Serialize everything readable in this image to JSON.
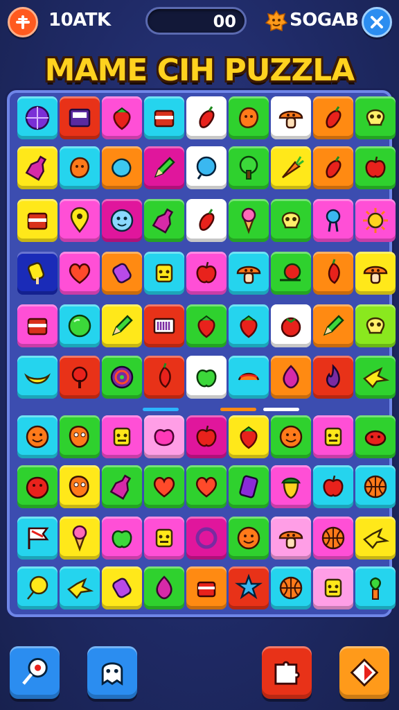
{
  "topbar": {
    "left_label": "10ATK",
    "score": "00",
    "right_label": "SOGAB"
  },
  "title": "MAME CIH PUZZLA",
  "colors": {
    "cyan": "#25d4ee",
    "red": "#e83218",
    "pink": "#ff4fd6",
    "green": "#2fd12e",
    "orange": "#ff8a12",
    "yellow": "#ffe81a",
    "lime": "#8ae81e",
    "white": "#ffffff",
    "navy": "#1a2bb8",
    "magenta": "#e0169c",
    "lightpink": "#ff9ee6",
    "blue": "#27b8ef"
  },
  "board": {
    "rows": [
      [
        {
          "color": "cyan",
          "icon": "purple-ball-icon"
        },
        {
          "color": "red",
          "icon": "tablet-icon"
        },
        {
          "color": "pink",
          "icon": "strawberry-icon"
        },
        {
          "color": "cyan",
          "icon": "box-icon"
        },
        {
          "color": "white",
          "icon": "red-pepper-icon"
        },
        {
          "color": "green",
          "icon": "orange-blob-icon"
        },
        {
          "color": "white",
          "icon": "mushroom-icon"
        },
        {
          "color": "orange",
          "icon": "red-pepper-icon"
        },
        {
          "color": "green",
          "icon": "skull-icon"
        }
      ],
      [
        {
          "color": "yellow",
          "icon": "bottle-icon"
        },
        {
          "color": "cyan",
          "icon": "orange-blob-icon"
        },
        {
          "color": "orange",
          "icon": "blue-blob-icon"
        },
        {
          "color": "magenta",
          "icon": "pencil-icon"
        },
        {
          "color": "white",
          "icon": "blue-ball-icon"
        },
        {
          "color": "green",
          "icon": "tree-icon"
        },
        {
          "color": "yellow",
          "icon": "carrot-icon"
        },
        {
          "color": "orange",
          "icon": "red-pepper-icon"
        },
        {
          "color": "green",
          "icon": "apple-icon"
        }
      ],
      [
        {
          "color": "yellow",
          "icon": "box-icon"
        },
        {
          "color": "pink",
          "icon": "location-pin-icon"
        },
        {
          "color": "magenta",
          "icon": "face-icon"
        },
        {
          "color": "green",
          "icon": "bottle-icon"
        },
        {
          "color": "white",
          "icon": "red-pepper-icon"
        },
        {
          "color": "green",
          "icon": "ice-cream-icon"
        },
        {
          "color": "green",
          "icon": "skull-icon"
        },
        {
          "color": "pink",
          "icon": "key-icon"
        },
        {
          "color": "pink",
          "icon": "sun-icon"
        }
      ],
      [
        {
          "color": "navy",
          "icon": "popsicle-icon"
        },
        {
          "color": "pink",
          "icon": "heart-icon"
        },
        {
          "color": "orange",
          "icon": "candy-bar-icon"
        },
        {
          "color": "cyan",
          "icon": "robot-icon"
        },
        {
          "color": "pink",
          "icon": "apple-icon"
        },
        {
          "color": "cyan",
          "icon": "mushroom-icon"
        },
        {
          "color": "green",
          "icon": "snail-icon"
        },
        {
          "color": "orange",
          "icon": "pepper-icon"
        },
        {
          "color": "yellow",
          "icon": "mushroom-icon"
        }
      ],
      [
        {
          "color": "pink",
          "icon": "box-icon"
        },
        {
          "color": "cyan",
          "icon": "green-ball-icon"
        },
        {
          "color": "yellow",
          "icon": "pencil-icon"
        },
        {
          "color": "red",
          "icon": "barcode-icon"
        },
        {
          "color": "green",
          "icon": "strawberry-icon"
        },
        {
          "color": "cyan",
          "icon": "strawberry-icon"
        },
        {
          "color": "white",
          "icon": "tomato-icon"
        },
        {
          "color": "orange",
          "icon": "pencil-icon"
        },
        {
          "color": "lime",
          "icon": "skull-icon"
        }
      ],
      [
        {
          "color": "cyan",
          "icon": "banana-icon"
        },
        {
          "color": "red",
          "icon": "flower-icon"
        },
        {
          "color": "green",
          "icon": "swirl-icon"
        },
        {
          "color": "red",
          "icon": "pepper-icon"
        },
        {
          "color": "white",
          "icon": "green-apple-icon"
        },
        {
          "color": "cyan",
          "icon": "candy-icon"
        },
        {
          "color": "orange",
          "icon": "onion-icon"
        },
        {
          "color": "red",
          "icon": "flame-icon"
        },
        {
          "color": "green",
          "icon": "bird-icon"
        }
      ],
      [
        {
          "color": "cyan",
          "icon": "smiley-icon"
        },
        {
          "color": "green",
          "icon": "monster-icon"
        },
        {
          "color": "pink",
          "icon": "robot-icon"
        },
        {
          "color": "lightpink",
          "icon": "peach-icon"
        },
        {
          "color": "magenta",
          "icon": "apple-icon"
        },
        {
          "color": "yellow",
          "icon": "strawberry-icon"
        },
        {
          "color": "green",
          "icon": "smiley-icon"
        },
        {
          "color": "pink",
          "icon": "robot-icon"
        },
        {
          "color": "green",
          "icon": "crab-icon"
        }
      ],
      [
        {
          "color": "green",
          "icon": "blob-face-icon"
        },
        {
          "color": "yellow",
          "icon": "monster-icon"
        },
        {
          "color": "green",
          "icon": "bottle-icon"
        },
        {
          "color": "green",
          "icon": "heart-icon"
        },
        {
          "color": "green",
          "icon": "heart-icon"
        },
        {
          "color": "green",
          "icon": "cup-icon"
        },
        {
          "color": "pink",
          "icon": "acorn-icon"
        },
        {
          "color": "cyan",
          "icon": "apple-icon"
        },
        {
          "color": "cyan",
          "icon": "basketball-icon"
        }
      ],
      [
        {
          "color": "cyan",
          "icon": "flag-icon"
        },
        {
          "color": "yellow",
          "icon": "ice-cream-icon"
        },
        {
          "color": "pink",
          "icon": "green-apple-icon"
        },
        {
          "color": "pink",
          "icon": "robot-icon"
        },
        {
          "color": "magenta",
          "icon": "ring-icon"
        },
        {
          "color": "green",
          "icon": "smiley-icon"
        },
        {
          "color": "lightpink",
          "icon": "mushroom-icon"
        },
        {
          "color": "pink",
          "icon": "basketball-icon"
        },
        {
          "color": "yellow",
          "icon": "bird-icon"
        }
      ],
      [
        {
          "color": "cyan",
          "icon": "balloon-icon"
        },
        {
          "color": "cyan",
          "icon": "bird-icon"
        },
        {
          "color": "yellow",
          "icon": "candy-bar-icon"
        },
        {
          "color": "green",
          "icon": "onion-icon"
        },
        {
          "color": "orange",
          "icon": "cake-icon"
        },
        {
          "color": "red",
          "icon": "star-icon"
        },
        {
          "color": "cyan",
          "icon": "basketball-icon"
        },
        {
          "color": "lightpink",
          "icon": "robot-icon"
        },
        {
          "color": "cyan",
          "icon": "plant-icon"
        }
      ]
    ]
  },
  "bottom_buttons": [
    {
      "name": "racket-button",
      "icon": "racket-icon",
      "color": "#2b8df0"
    },
    {
      "name": "ghost-button",
      "icon": "ghost-icon",
      "color": "#2b8df0"
    },
    {
      "name": "puzzle-button",
      "icon": "puzzle-icon",
      "color": "#e83218"
    },
    {
      "name": "diamond-button",
      "icon": "diamond-icon",
      "color": "#ff9a1a"
    }
  ]
}
